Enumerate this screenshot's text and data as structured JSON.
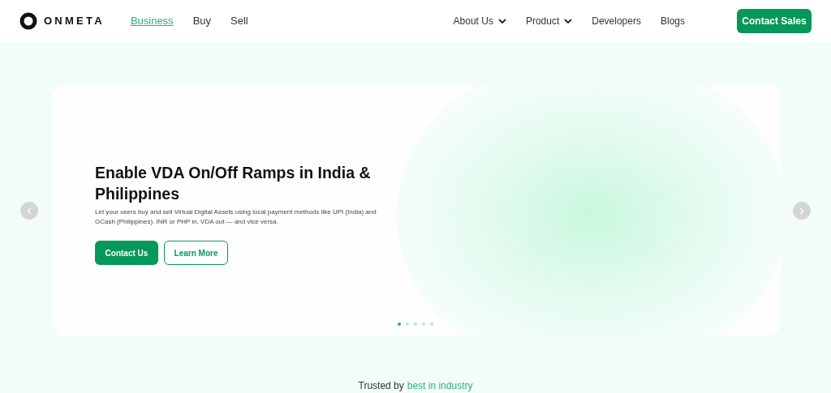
{
  "header": {
    "logo": "ONMETA",
    "left_nav": [
      {
        "label": "Business",
        "selected": true
      },
      {
        "label": "Buy",
        "selected": false
      },
      {
        "label": "Sell",
        "selected": false
      }
    ],
    "right_nav": [
      {
        "label": "About Us",
        "has_menu": true
      },
      {
        "label": "Product",
        "has_menu": true
      },
      {
        "label": "Developers",
        "has_menu": false
      },
      {
        "label": "Blogs",
        "has_menu": false
      }
    ],
    "cta": "Contact Sales"
  },
  "hero": {
    "title": "Enable VDA On/Off Ramps in India & Philippines",
    "description": "Let your users buy and sell Virtual Digital Assets using local payment methods like UPI (India) and GCash (Philippines). INR or PHP in, VDA out — and vice versa.",
    "primary_button": "Contact Us",
    "secondary_button": "Learn More",
    "dots": [
      {
        "selected": true
      },
      {
        "selected": false
      },
      {
        "selected": false
      },
      {
        "selected": false
      },
      {
        "selected": false
      }
    ]
  },
  "trusted": {
    "prefix": "Trusted by",
    "highlight": "best in industry"
  }
}
